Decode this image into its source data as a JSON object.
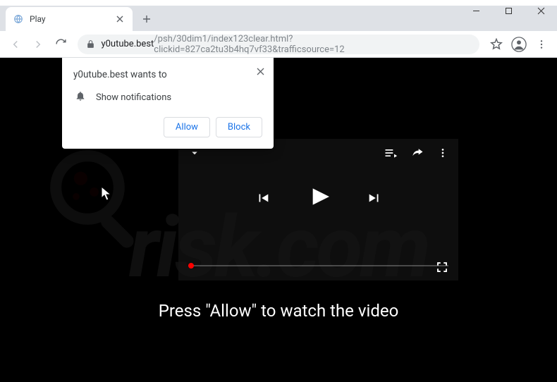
{
  "window": {
    "tab_title": "Play"
  },
  "toolbar": {
    "url_host": "y0utube.best",
    "url_path": "/psh/30dim1/index123clear.html?clickid=827ca2tu3b4hq7vf33&trafficsource=12"
  },
  "permission_dialog": {
    "title": "y0utube.best wants to",
    "row_label": "Show notifications",
    "allow_label": "Allow",
    "block_label": "Block"
  },
  "page": {
    "instruction": "Press \"Allow\" to watch the video"
  },
  "watermark": {
    "line2": "risk.com"
  }
}
